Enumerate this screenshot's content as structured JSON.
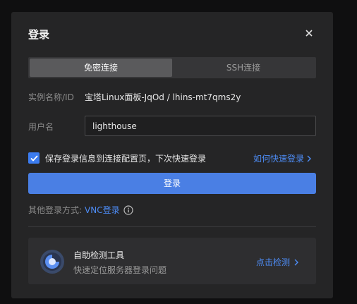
{
  "dialog": {
    "title": "登录",
    "close_icon": "close-icon"
  },
  "tabs": [
    {
      "label": "免密连接",
      "active": true
    },
    {
      "label": "SSH连接",
      "active": false
    }
  ],
  "instance": {
    "label": "实例名称/ID",
    "value": "宝塔Linux面板-JqOd / lhins-mt7qms2y"
  },
  "user": {
    "label": "用户名",
    "value": "lighthouse"
  },
  "remember": {
    "checked": true,
    "label": "保存登录信息到连接配置页，下次快速登录",
    "link": "如何快速登录"
  },
  "login_button": "登录",
  "other": {
    "label": "其他登录方式:",
    "vnc": "VNC登录",
    "icon": "info-icon"
  },
  "tool": {
    "title": "自助检测工具",
    "subtitle": "快速定位服务器登录问题",
    "link": "点击检测"
  },
  "colors": {
    "accent": "#4a7fe4",
    "link": "#4d8cf5",
    "dialog_bg": "#252526"
  }
}
